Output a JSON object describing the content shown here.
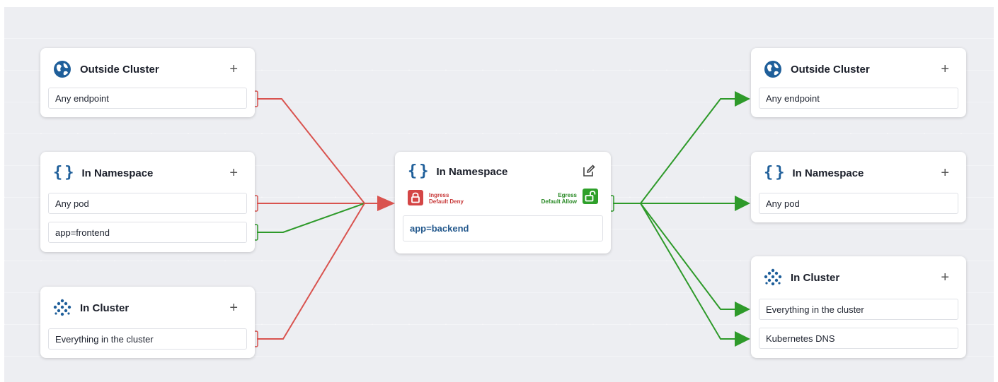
{
  "left_cards": [
    {
      "title": "Outside Cluster",
      "icon": "globe-icon",
      "rows": [
        "Any endpoint"
      ]
    },
    {
      "title": "In Namespace",
      "icon": "braces-icon",
      "rows": [
        "Any pod",
        "app=frontend"
      ]
    },
    {
      "title": "In Cluster",
      "icon": "cluster-icon",
      "rows": [
        "Everything in the cluster"
      ]
    }
  ],
  "center_card": {
    "title": "In Namespace",
    "icon": "braces-icon",
    "ingress_label": "Ingress",
    "ingress_policy": "Default Deny",
    "egress_label": "Egress",
    "egress_policy": "Default Allow",
    "selector": "app=backend"
  },
  "right_cards": [
    {
      "title": "Outside Cluster",
      "icon": "globe-icon",
      "rows": [
        "Any endpoint"
      ]
    },
    {
      "title": "In Namespace",
      "icon": "braces-icon",
      "rows": [
        "Any pod"
      ]
    },
    {
      "title": "In Cluster",
      "icon": "cluster-icon",
      "rows": [
        "Everything in the cluster",
        "Kubernetes DNS"
      ]
    }
  ],
  "colors": {
    "deny": "#d9534f",
    "allow": "#2e9a2a",
    "brand": "#1f5f9a"
  }
}
